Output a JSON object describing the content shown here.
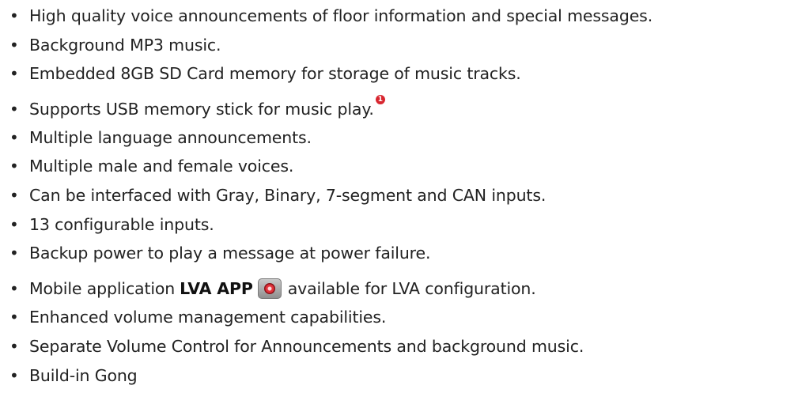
{
  "bullet": "•",
  "features": [
    "High quality voice announcements of floor information and special messages.",
    "Background MP3 music.",
    "Embedded 8GB SD Card memory for storage of music tracks.",
    "Supports USB memory stick  for music play.",
    "Multiple language announcements.",
    "Multiple male and female voices.",
    "Can be interfaced with Gray, Binary, 7-segment and CAN inputs.",
    "13 configurable inputs.",
    "Backup power to play a message at power failure.",
    {
      "before": "Mobile application",
      "app_name": "LVA APP",
      "icon": "lva-app-icon",
      "after": "available for LVA configuration."
    },
    "Enhanced volume management capabilities.",
    "Separate Volume Control for Announcements and background music.",
    "Build-in Gong"
  ],
  "note_marker": "1",
  "colors": {
    "text": "#222222",
    "note_marker": "#d8262f"
  }
}
